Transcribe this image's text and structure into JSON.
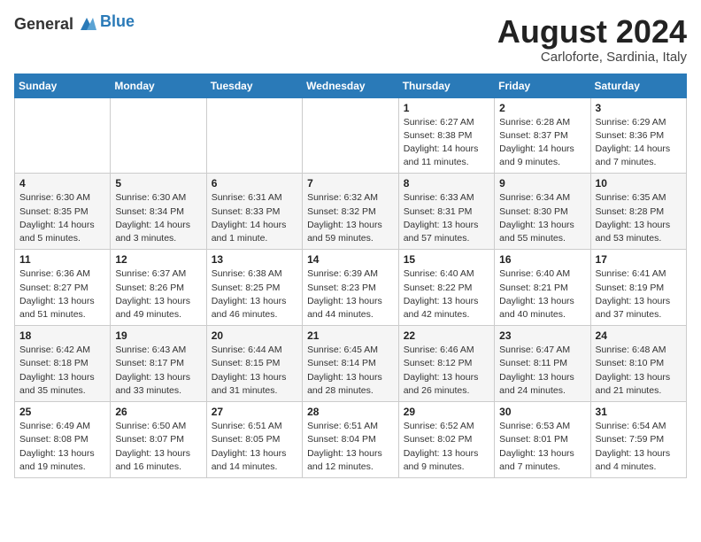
{
  "header": {
    "logo_general": "General",
    "logo_blue": "Blue",
    "title": "August 2024",
    "location": "Carloforte, Sardinia, Italy"
  },
  "days_of_week": [
    "Sunday",
    "Monday",
    "Tuesday",
    "Wednesday",
    "Thursday",
    "Friday",
    "Saturday"
  ],
  "weeks": [
    [
      {
        "day": "",
        "info": ""
      },
      {
        "day": "",
        "info": ""
      },
      {
        "day": "",
        "info": ""
      },
      {
        "day": "",
        "info": ""
      },
      {
        "day": "1",
        "info": "Sunrise: 6:27 AM\nSunset: 8:38 PM\nDaylight: 14 hours and 11 minutes."
      },
      {
        "day": "2",
        "info": "Sunrise: 6:28 AM\nSunset: 8:37 PM\nDaylight: 14 hours and 9 minutes."
      },
      {
        "day": "3",
        "info": "Sunrise: 6:29 AM\nSunset: 8:36 PM\nDaylight: 14 hours and 7 minutes."
      }
    ],
    [
      {
        "day": "4",
        "info": "Sunrise: 6:30 AM\nSunset: 8:35 PM\nDaylight: 14 hours and 5 minutes."
      },
      {
        "day": "5",
        "info": "Sunrise: 6:30 AM\nSunset: 8:34 PM\nDaylight: 14 hours and 3 minutes."
      },
      {
        "day": "6",
        "info": "Sunrise: 6:31 AM\nSunset: 8:33 PM\nDaylight: 14 hours and 1 minute."
      },
      {
        "day": "7",
        "info": "Sunrise: 6:32 AM\nSunset: 8:32 PM\nDaylight: 13 hours and 59 minutes."
      },
      {
        "day": "8",
        "info": "Sunrise: 6:33 AM\nSunset: 8:31 PM\nDaylight: 13 hours and 57 minutes."
      },
      {
        "day": "9",
        "info": "Sunrise: 6:34 AM\nSunset: 8:30 PM\nDaylight: 13 hours and 55 minutes."
      },
      {
        "day": "10",
        "info": "Sunrise: 6:35 AM\nSunset: 8:28 PM\nDaylight: 13 hours and 53 minutes."
      }
    ],
    [
      {
        "day": "11",
        "info": "Sunrise: 6:36 AM\nSunset: 8:27 PM\nDaylight: 13 hours and 51 minutes."
      },
      {
        "day": "12",
        "info": "Sunrise: 6:37 AM\nSunset: 8:26 PM\nDaylight: 13 hours and 49 minutes."
      },
      {
        "day": "13",
        "info": "Sunrise: 6:38 AM\nSunset: 8:25 PM\nDaylight: 13 hours and 46 minutes."
      },
      {
        "day": "14",
        "info": "Sunrise: 6:39 AM\nSunset: 8:23 PM\nDaylight: 13 hours and 44 minutes."
      },
      {
        "day": "15",
        "info": "Sunrise: 6:40 AM\nSunset: 8:22 PM\nDaylight: 13 hours and 42 minutes."
      },
      {
        "day": "16",
        "info": "Sunrise: 6:40 AM\nSunset: 8:21 PM\nDaylight: 13 hours and 40 minutes."
      },
      {
        "day": "17",
        "info": "Sunrise: 6:41 AM\nSunset: 8:19 PM\nDaylight: 13 hours and 37 minutes."
      }
    ],
    [
      {
        "day": "18",
        "info": "Sunrise: 6:42 AM\nSunset: 8:18 PM\nDaylight: 13 hours and 35 minutes."
      },
      {
        "day": "19",
        "info": "Sunrise: 6:43 AM\nSunset: 8:17 PM\nDaylight: 13 hours and 33 minutes."
      },
      {
        "day": "20",
        "info": "Sunrise: 6:44 AM\nSunset: 8:15 PM\nDaylight: 13 hours and 31 minutes."
      },
      {
        "day": "21",
        "info": "Sunrise: 6:45 AM\nSunset: 8:14 PM\nDaylight: 13 hours and 28 minutes."
      },
      {
        "day": "22",
        "info": "Sunrise: 6:46 AM\nSunset: 8:12 PM\nDaylight: 13 hours and 26 minutes."
      },
      {
        "day": "23",
        "info": "Sunrise: 6:47 AM\nSunset: 8:11 PM\nDaylight: 13 hours and 24 minutes."
      },
      {
        "day": "24",
        "info": "Sunrise: 6:48 AM\nSunset: 8:10 PM\nDaylight: 13 hours and 21 minutes."
      }
    ],
    [
      {
        "day": "25",
        "info": "Sunrise: 6:49 AM\nSunset: 8:08 PM\nDaylight: 13 hours and 19 minutes."
      },
      {
        "day": "26",
        "info": "Sunrise: 6:50 AM\nSunset: 8:07 PM\nDaylight: 13 hours and 16 minutes."
      },
      {
        "day": "27",
        "info": "Sunrise: 6:51 AM\nSunset: 8:05 PM\nDaylight: 13 hours and 14 minutes."
      },
      {
        "day": "28",
        "info": "Sunrise: 6:51 AM\nSunset: 8:04 PM\nDaylight: 13 hours and 12 minutes."
      },
      {
        "day": "29",
        "info": "Sunrise: 6:52 AM\nSunset: 8:02 PM\nDaylight: 13 hours and 9 minutes."
      },
      {
        "day": "30",
        "info": "Sunrise: 6:53 AM\nSunset: 8:01 PM\nDaylight: 13 hours and 7 minutes."
      },
      {
        "day": "31",
        "info": "Sunrise: 6:54 AM\nSunset: 7:59 PM\nDaylight: 13 hours and 4 minutes."
      }
    ]
  ]
}
